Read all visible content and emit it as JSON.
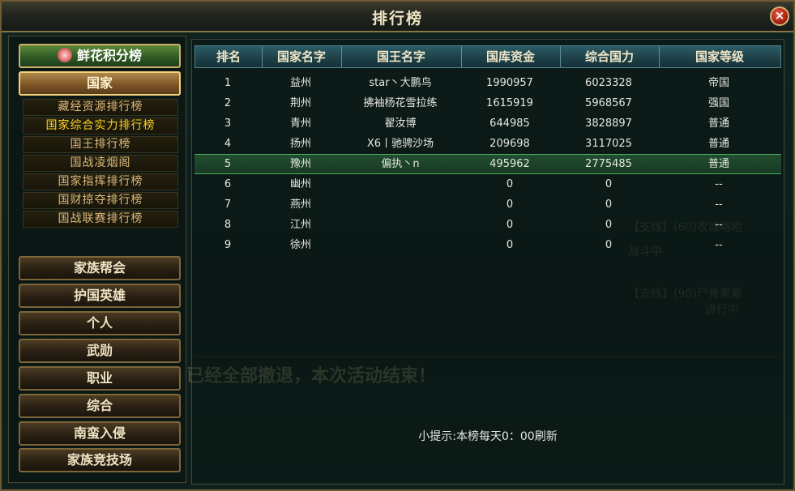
{
  "window": {
    "title": "排行榜",
    "close_label": "×"
  },
  "sidebar": {
    "flower_button": "鲜花积分榜",
    "country_button": "国家",
    "sub_items": [
      "藏经资源排行榜",
      "国家综合实力排行榜",
      "国王排行榜",
      "国战凌烟阁",
      "国家指挥排行榜",
      "国财掠夺排行榜",
      "国战联赛排行榜"
    ],
    "active_sub_index": 1,
    "categories": [
      "家族帮会",
      "护国英雄",
      "个人",
      "武勋",
      "职业",
      "综合",
      "南蛮入侵",
      "家族竞技场"
    ]
  },
  "table": {
    "headers": [
      "排名",
      "国家名字",
      "国王名字",
      "国库资金",
      "综合国力",
      "国家等级"
    ],
    "rows": [
      [
        "1",
        "益州",
        "star丶大鹏鸟",
        "1990957",
        "6023328",
        "帝国"
      ],
      [
        "2",
        "荆州",
        "拂袖杨花雪拉练",
        "1615919",
        "5968567",
        "强国"
      ],
      [
        "3",
        "青州",
        "翟汝博",
        "644985",
        "3828897",
        "普通"
      ],
      [
        "4",
        "扬州",
        "X6丨驰骋沙场",
        "209698",
        "3117025",
        "普通"
      ],
      [
        "5",
        "豫州",
        "偏执丶n",
        "495962",
        "2775485",
        "普通"
      ],
      [
        "6",
        "幽州",
        "",
        "0",
        "0",
        "--"
      ],
      [
        "7",
        "燕州",
        "",
        "0",
        "0",
        "--"
      ],
      [
        "8",
        "江州",
        "",
        "0",
        "0",
        "--"
      ],
      [
        "9",
        "徐州",
        "",
        "0",
        "0",
        "--"
      ]
    ],
    "selected_row_index": 4
  },
  "tip": "小提示:本榜每天0：00刷新",
  "background": {
    "announcement": "已经全部撤退，本次活动结束！",
    "quest_lines": [
      "【支线】(60)攻城略地",
      "【支线】(90)尸骨累累",
      "战斗中",
      "进行中"
    ]
  }
}
